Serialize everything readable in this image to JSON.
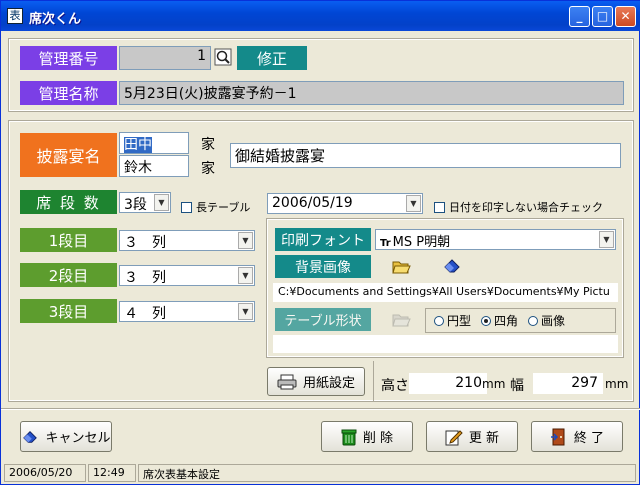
{
  "window": {
    "title": "席次くん",
    "app_icon_glyph": "表",
    "min_glyph": "_",
    "max_glyph": "□",
    "close_glyph": "✕"
  },
  "kanri_bango": {
    "label": "管理番号",
    "value": "1",
    "edit_label": "修正"
  },
  "kanri_meisho": {
    "label": "管理名称",
    "value": "5月23日(火)披露宴予約－1"
  },
  "hiroen": {
    "label": "披露宴名",
    "name1": "田中",
    "name2": "鈴木",
    "ie1": "家",
    "ie2": "家",
    "title": "御結婚披露宴"
  },
  "seki_dansu": {
    "label": "席 段 数",
    "value": "3段",
    "long_table_label": "長テーブル"
  },
  "date": {
    "value": "2006/05/19",
    "no_print_label": "日付を印字しない場合チェック"
  },
  "rows": [
    {
      "label": "1段目",
      "value": "３　列"
    },
    {
      "label": "2段目",
      "value": "３　列"
    },
    {
      "label": "3段目",
      "value": "４　列"
    }
  ],
  "print_font": {
    "label": "印刷フォント",
    "value": "MS P明朝",
    "font_icon": "Tr"
  },
  "background_image": {
    "label": "背景画像",
    "path": "C:¥Documents and Settings¥All Users¥Documents¥My Pictu"
  },
  "table_shape": {
    "label": "テーブル形状",
    "options": [
      "円型",
      "四角",
      "画像"
    ],
    "selected": "四角"
  },
  "paper": {
    "button_label": "用紙設定",
    "height_label": "高さ",
    "height_value": "210",
    "height_unit": "mm",
    "width_label": "幅",
    "width_value": "297",
    "width_unit": "mm"
  },
  "buttons": {
    "cancel": "キャンセル",
    "delete": "削 除",
    "update": "更 新",
    "exit": "終 了"
  },
  "status": {
    "date": "2006/05/20",
    "time": "12:49",
    "mode": "席次表基本設定"
  },
  "colors": {
    "purple": "#7b3fe6",
    "orange": "#f0721e",
    "green": "#1e8430",
    "light_green": "#5d9d2e",
    "teal": "#148a8a"
  }
}
